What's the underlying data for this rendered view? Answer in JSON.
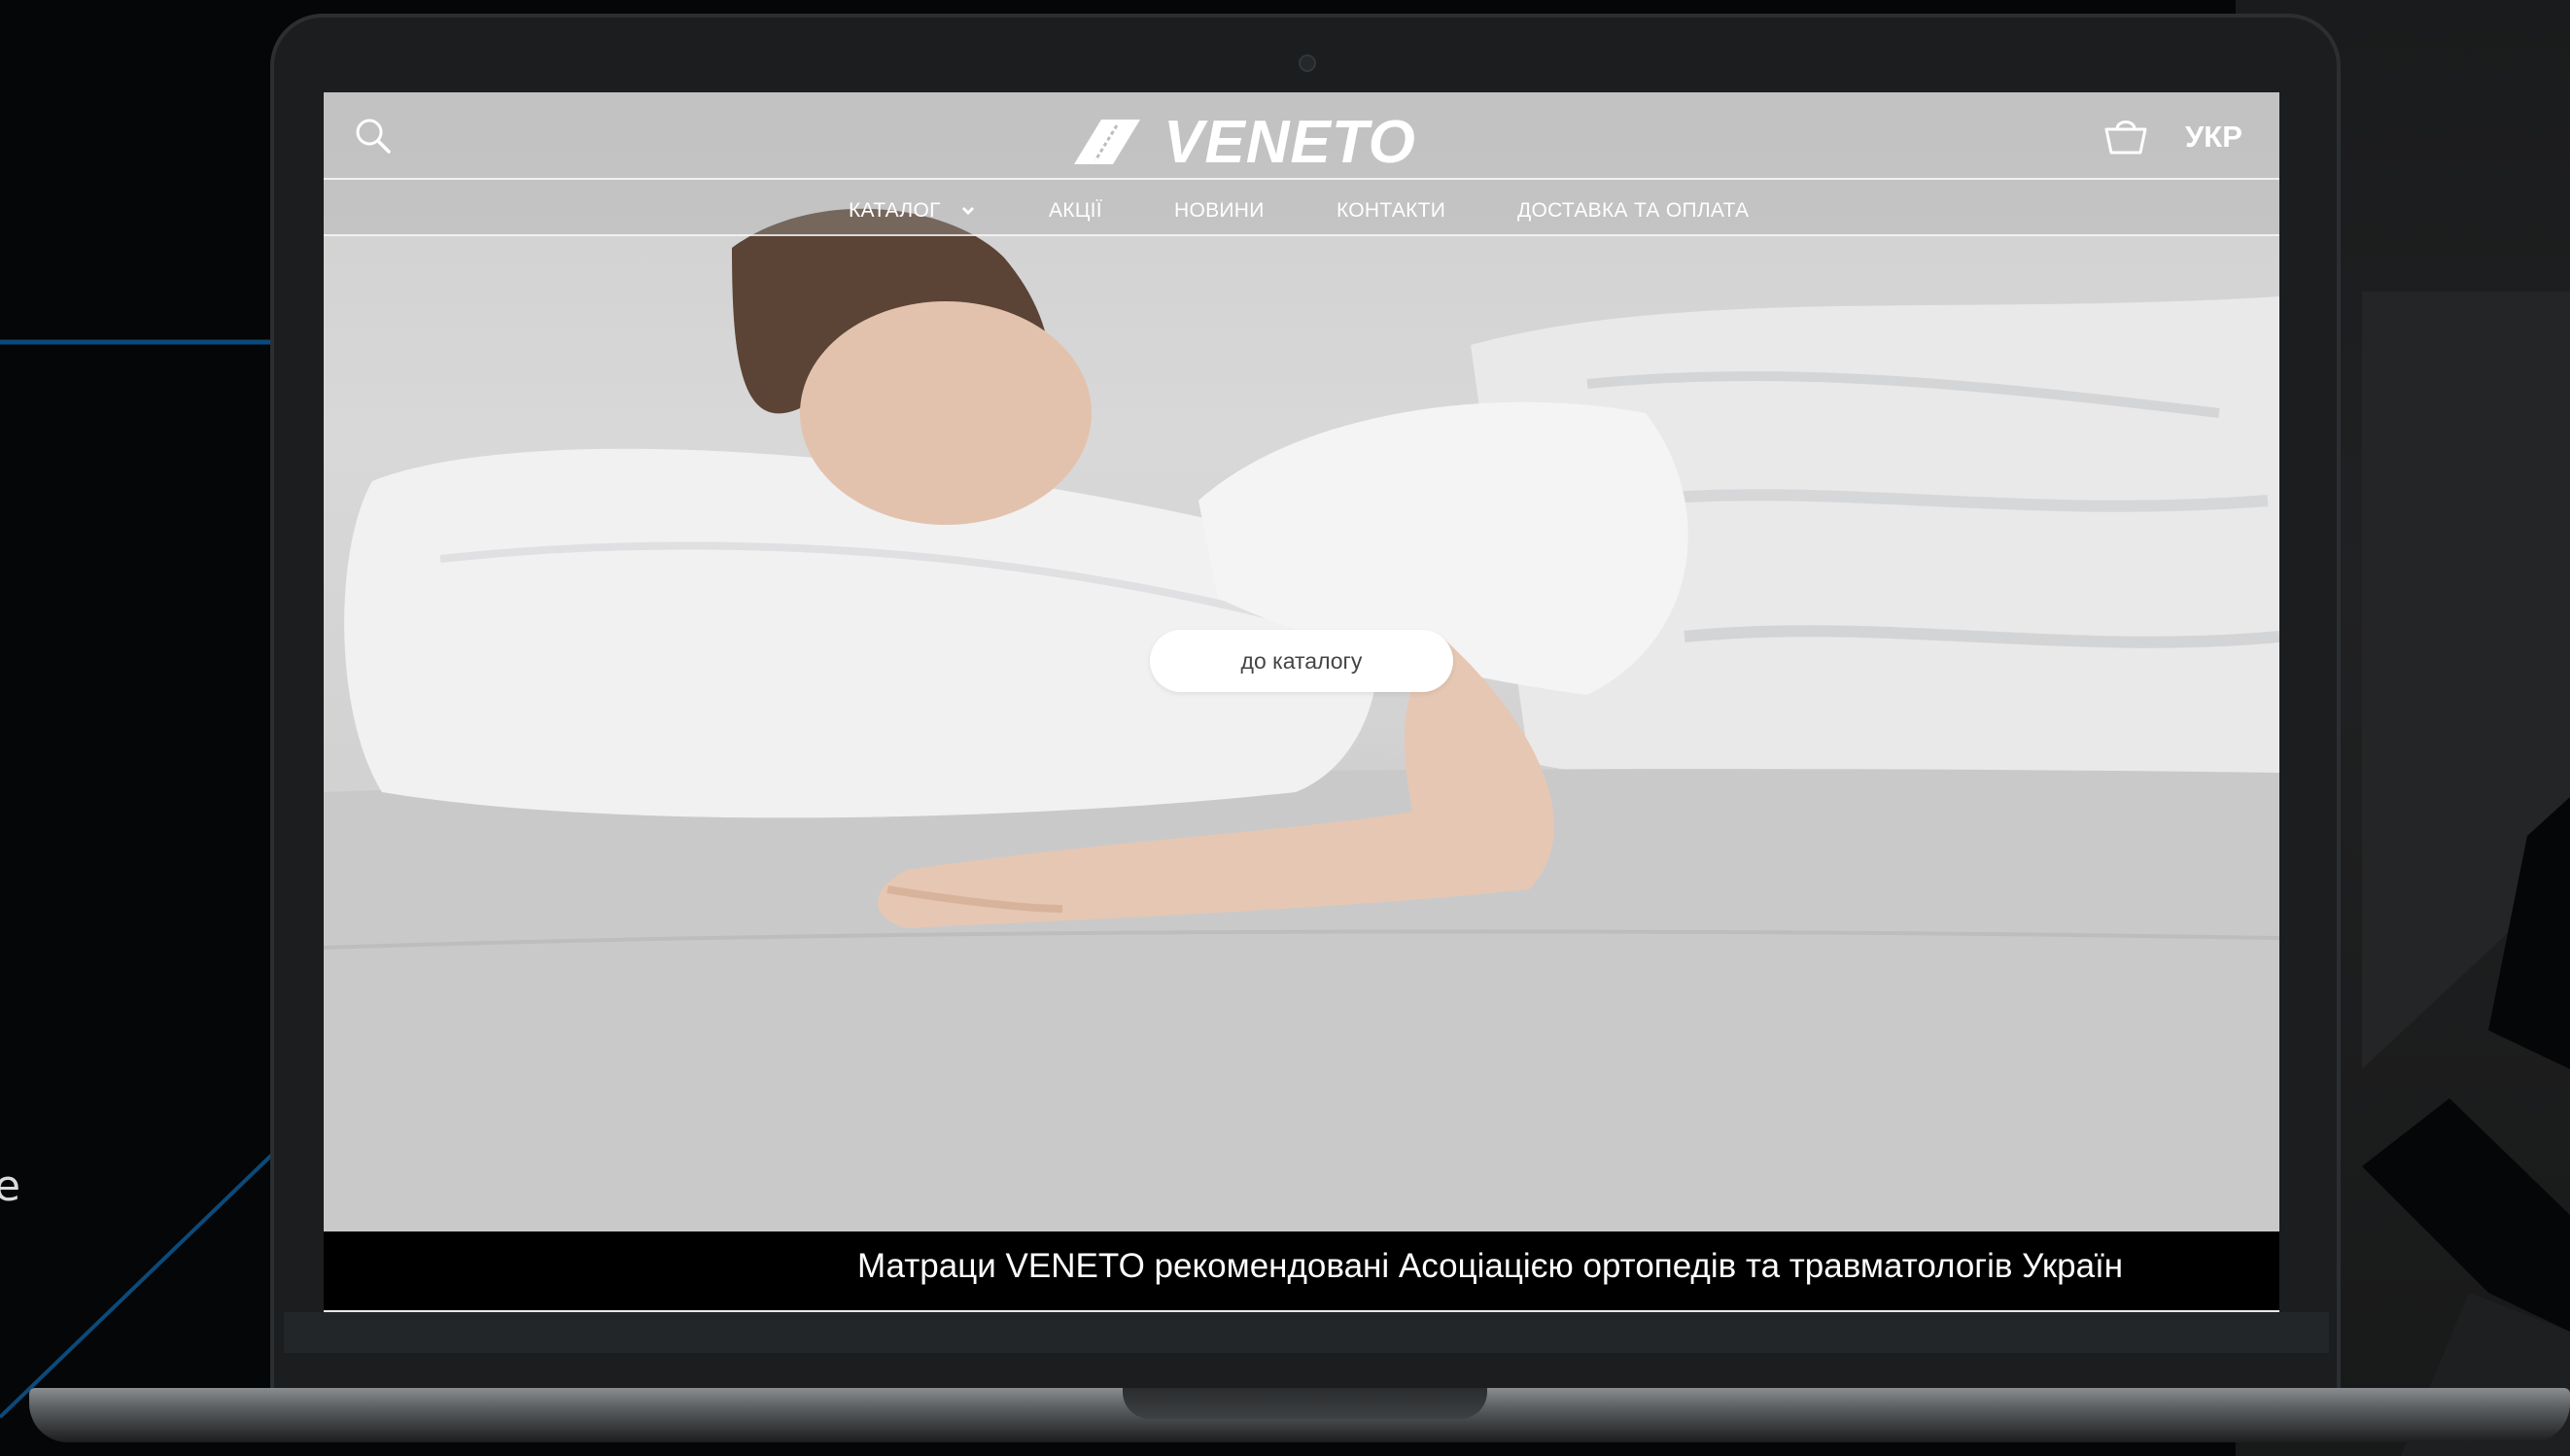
{
  "site": {
    "brand": "VENETO",
    "header": {
      "language": "УКР"
    },
    "nav": [
      {
        "label": "КАТАЛОГ"
      },
      {
        "label": "АКЦІЇ"
      },
      {
        "label": "НОВИНИ"
      },
      {
        "label": "КОНТАКТИ"
      },
      {
        "label": "ДОСТАВКА ТА ОПЛАТА"
      }
    ],
    "hero": {
      "cta_label": "до каталогу"
    },
    "ticker": {
      "text": "Матраци VENETO рекомендовані Асоціацією ортопедів та травматологів Україн"
    }
  },
  "background": {
    "side_text": "e"
  },
  "icons": {
    "search": "search-icon",
    "cart": "basket-icon",
    "dropdown": "chevron-down-icon"
  },
  "colors": {
    "stage_bg": "#050607",
    "accent_line": "#0b4a7a",
    "ticker_bg": "#000000",
    "cta_bg": "#ffffff"
  }
}
